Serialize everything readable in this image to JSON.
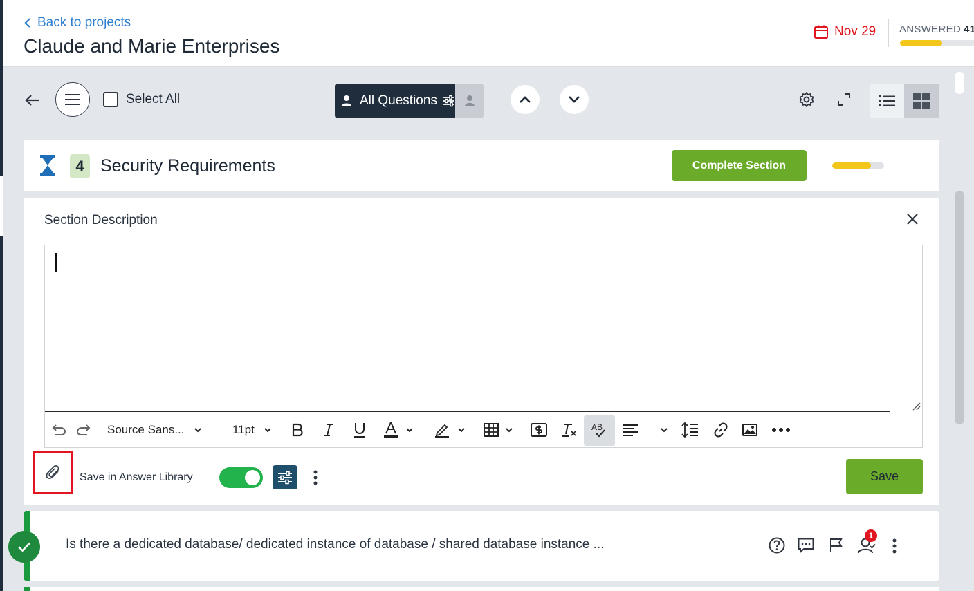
{
  "header": {
    "back_link": "Back to projects",
    "title": "Claude and Marie Enterprises",
    "due_date": "Nov 29",
    "answered_label": "ANSWERED",
    "answered_count": "41",
    "answered_progress": 0.55
  },
  "toolbar": {
    "select_all": "Select All",
    "filter_label": "All Questions"
  },
  "section": {
    "number": "4",
    "title": "Security Requirements",
    "complete_button": "Complete Section",
    "progress": 0.75
  },
  "description": {
    "title": "Section Description",
    "value": "",
    "editor_toolbar": {
      "font_family": "Source Sans...",
      "font_size": "11pt"
    },
    "save_in_library_label": "Save in Answer Library",
    "save_in_library_enabled": true,
    "save_button": "Save"
  },
  "question": {
    "text": "Is there a dedicated database/ dedicated instance of database / shared database instance ...",
    "assignee_count": "1",
    "status": "complete"
  },
  "colors": {
    "accent_green": "#6aab29",
    "dark_navy": "#1f2d3d",
    "due_red": "#e0151f",
    "progress_yellow": "#f3c61a",
    "toggle_green": "#22b34c"
  },
  "icons": [
    "chevron-left-icon",
    "calendar-icon",
    "arrow-left-icon",
    "hamburger-icon",
    "users-icon",
    "sliders-icon",
    "user-icon",
    "chevron-up-icon",
    "chevron-down-icon",
    "gear-icon",
    "expand-icon",
    "list-view-icon",
    "grid-view-icon",
    "hourglass-icon",
    "close-icon",
    "undo-icon",
    "redo-icon",
    "bold-icon",
    "italic-icon",
    "underline-icon",
    "text-color-icon",
    "highlight-icon",
    "table-icon",
    "merge-tag-icon",
    "clear-format-icon",
    "spellcheck-icon",
    "align-icon",
    "line-height-icon",
    "link-icon",
    "image-icon",
    "more-icon",
    "paperclip-icon",
    "kebab-icon",
    "check-icon",
    "help-icon",
    "comment-icon",
    "flag-icon",
    "assignees-icon"
  ]
}
